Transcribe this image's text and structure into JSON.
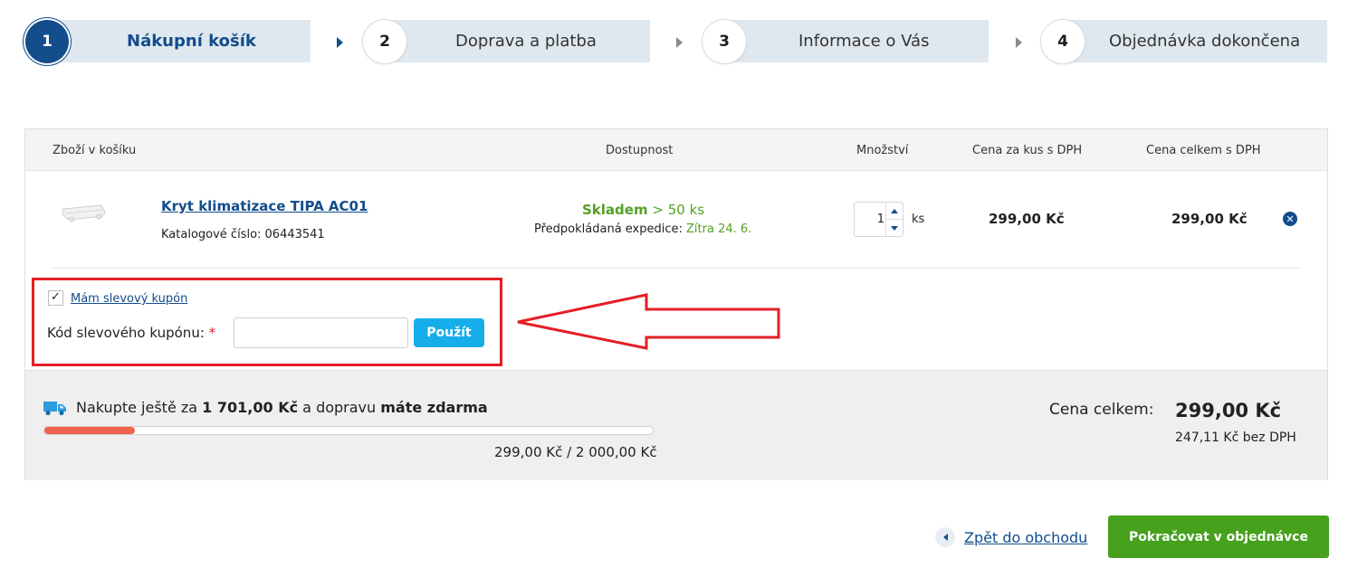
{
  "steps": [
    {
      "number": "1",
      "label": "Nákupní košík",
      "active": true
    },
    {
      "number": "2",
      "label": "Doprava a platba",
      "active": false
    },
    {
      "number": "3",
      "label": "Informace o Vás",
      "active": false
    },
    {
      "number": "4",
      "label": "Objednávka dokončena",
      "active": false
    }
  ],
  "table": {
    "headers": {
      "item": "Zboží v košíku",
      "availability": "Dostupnost",
      "quantity": "Množství",
      "unit_price": "Cena za kus s DPH",
      "total_price": "Cena celkem s DPH"
    }
  },
  "product": {
    "name": "Kryt klimatizace TIPA AC01",
    "catalog": "Katalogové číslo: 06443541",
    "stock_status": "Skladem",
    "stock_count": "> 50 ks",
    "expedition_label": "Předpokládaná expedice:",
    "expedition_date": "Zítra 24. 6.",
    "quantity": "1",
    "quantity_unit": "ks",
    "unit_price": "299,00 Kč",
    "total_price": "299,00 Kč",
    "remove_icon": "close-icon"
  },
  "coupon": {
    "checkbox_label": "Mám slevový kupón",
    "checked": true,
    "code_label": "Kód slevového kupónu:",
    "required_mark": "*",
    "input_value": "",
    "apply_button": "Použít"
  },
  "shipping": {
    "prefix": "Nakupte ještě za",
    "amount": "1 701,00 Kč",
    "middle": "a dopravu",
    "free": "máte zdarma",
    "progress_percent": 14.95,
    "progress_text": "299,00 Kč / 2 000,00 Kč",
    "icon": "truck-icon"
  },
  "totals": {
    "label": "Cena celkem:",
    "value": "299,00 Kč",
    "net": "247,11 Kč bez DPH"
  },
  "actions": {
    "back": "Zpět do obchodu",
    "continue": "Pokračovat v objednávce"
  },
  "colors": {
    "primary": "#134d8c",
    "success": "#46a11d",
    "stock_green": "#55a022",
    "coupon_button": "#16aeea",
    "annotation_red": "#e41f26",
    "progress_fill": "#f0624d"
  }
}
